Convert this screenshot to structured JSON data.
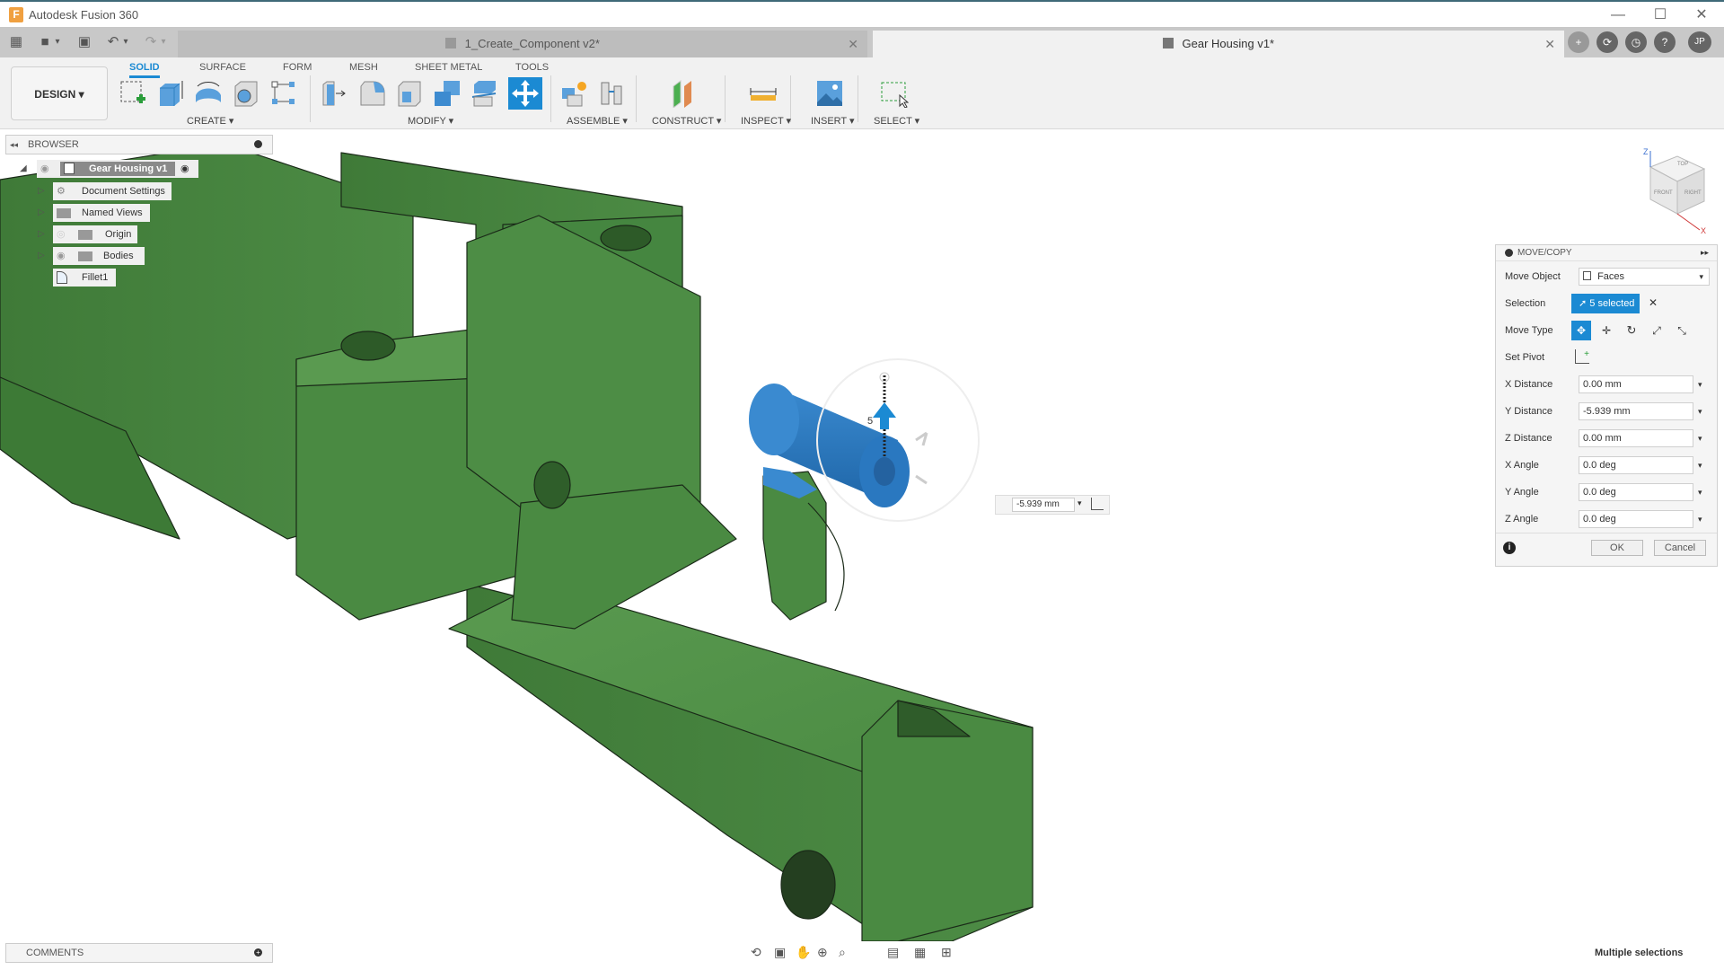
{
  "window": {
    "app_title": "Autodesk Fusion 360",
    "logo_letter": "F",
    "minimize": "—",
    "maximize": "☐",
    "close": "✕"
  },
  "quick_access": {
    "grid_icon": "▦",
    "file_icon": "■",
    "save_icon": "▣",
    "undo_icon": "↶",
    "redo_icon": "↷",
    "caret": "▾"
  },
  "tabs": [
    {
      "label": "1_Create_Component v2*",
      "active": false,
      "close": "✕"
    },
    {
      "label": "Gear Housing v1*",
      "active": true,
      "close": "✕"
    }
  ],
  "tab_right_icons": [
    "+",
    "⟳",
    "◷",
    "?",
    "JP"
  ],
  "workspace": {
    "label": "DESIGN",
    "caret": "▾"
  },
  "ribbon_tabs": [
    {
      "label": "SOLID",
      "active": true
    },
    {
      "label": "SURFACE"
    },
    {
      "label": "FORM"
    },
    {
      "label": "MESH"
    },
    {
      "label": "SHEET METAL"
    },
    {
      "label": "TOOLS"
    }
  ],
  "ribbon_groups": [
    {
      "label": "CREATE ▾"
    },
    {
      "label": "MODIFY ▾"
    },
    {
      "label": "ASSEMBLE ▾"
    },
    {
      "label": "CONSTRUCT ▾"
    },
    {
      "label": "INSPECT ▾"
    },
    {
      "label": "INSERT ▾"
    },
    {
      "label": "SELECT ▾"
    }
  ],
  "browser": {
    "title": "BROWSER",
    "collapse_icon": "◂◂",
    "items": [
      {
        "label": "Gear Housing v1",
        "root": true
      },
      {
        "label": "Document Settings"
      },
      {
        "label": "Named Views"
      },
      {
        "label": "Origin"
      },
      {
        "label": "Bodies"
      },
      {
        "label": "Fillet1"
      }
    ]
  },
  "viewcube": {
    "top": "TOP",
    "front": "FRONT",
    "right": "RIGHT",
    "z_axis": "Z",
    "x_axis": "X"
  },
  "manipulator": {
    "value": "-5.939 mm",
    "caret": "▾",
    "arrow_label": "5"
  },
  "move_copy": {
    "title": "MOVE/COPY",
    "expand_icon": "▸▸",
    "rows": {
      "move_object": {
        "label": "Move Object",
        "value": "Faces"
      },
      "selection": {
        "label": "Selection",
        "value": "5 selected",
        "clear": "✕"
      },
      "move_type": {
        "label": "Move Type"
      },
      "set_pivot": {
        "label": "Set Pivot"
      },
      "x_distance": {
        "label": "X Distance",
        "value": "0.00 mm"
      },
      "y_distance": {
        "label": "Y Distance",
        "value": "-5.939 mm"
      },
      "z_distance": {
        "label": "Z Distance",
        "value": "0.00 mm"
      },
      "x_angle": {
        "label": "X Angle",
        "value": "0.0 deg"
      },
      "y_angle": {
        "label": "Y Angle",
        "value": "0.0 deg"
      },
      "z_angle": {
        "label": "Z Angle",
        "value": "0.0 deg"
      }
    },
    "ok": "OK",
    "cancel": "Cancel",
    "info_icon": "i"
  },
  "comments": {
    "title": "COMMENTS"
  },
  "status": {
    "text": "Multiple selections"
  },
  "colors": {
    "accent": "#1b8ad3",
    "model_green": "#4a8a42",
    "selected_blue": "#2f7fc1"
  }
}
